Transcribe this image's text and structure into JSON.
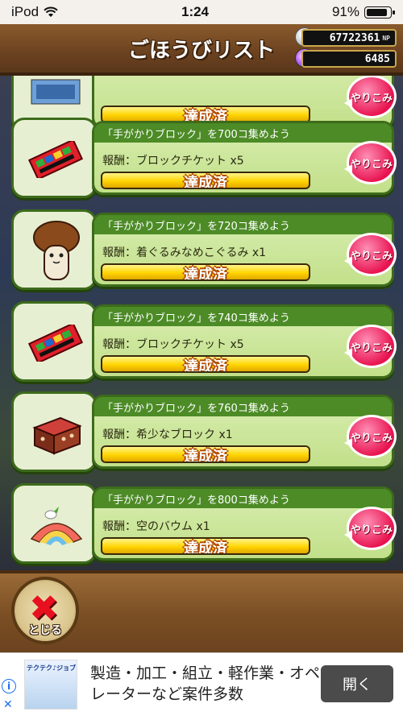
{
  "status_bar": {
    "carrier": "iPod",
    "time": "1:24",
    "battery": "91%",
    "battery_level": 0.91
  },
  "header": {
    "title": "ごほうびリスト",
    "np_value": "67722361",
    "np_unit": "NP",
    "gem_value": "6485"
  },
  "colors": {
    "accent_green": "#4c8b26",
    "button_pink": "#e8124f",
    "bar_yellow": "#ffd400"
  },
  "rewards": [
    {
      "title": "",
      "reward": "",
      "status": "達成済",
      "button": "やりこみ",
      "icon": "ticket-icon",
      "progress": 1
    },
    {
      "title": "「手がかりブロック」を700コ集めよう",
      "reward": "報酬：ブロックチケット x5",
      "status": "達成済",
      "button": "やりこみ",
      "icon": "block-ticket-icon",
      "progress": 1
    },
    {
      "title": "「手がかりブロック」を720コ集めよう",
      "reward": "報酬：着ぐるみなめこぐるみ x1",
      "status": "達成済",
      "button": "やりこみ",
      "icon": "nameko-costume-icon",
      "progress": 1
    },
    {
      "title": "「手がかりブロック」を740コ集めよう",
      "reward": "報酬：ブロックチケット x5",
      "status": "達成済",
      "button": "やりこみ",
      "icon": "block-ticket-icon",
      "progress": 1
    },
    {
      "title": "「手がかりブロック」を760コ集めよう",
      "reward": "報酬：希少なブロック x1",
      "status": "達成済",
      "button": "やりこみ",
      "icon": "rare-block-icon",
      "progress": 1
    },
    {
      "title": "「手がかりブロック」を800コ集めよう",
      "reward": "報酬：空のバウム x1",
      "status": "達成済",
      "button": "やりこみ",
      "icon": "rainbow-baum-icon",
      "progress": 1
    }
  ],
  "footer": {
    "close_label": "とじる"
  },
  "ad": {
    "logo_text": "テクテク♪ジョブ",
    "text": "製造・加工・組立・軽作業・オペレーターなど案件多数",
    "button": "開く"
  }
}
